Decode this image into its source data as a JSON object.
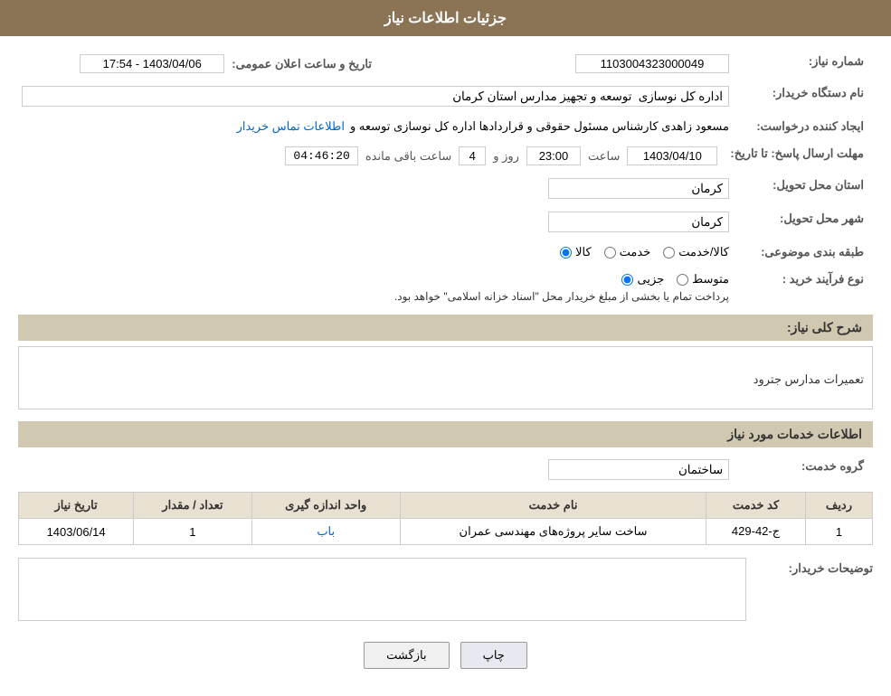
{
  "header": {
    "title": "جزئیات اطلاعات نیاز"
  },
  "section1": {
    "title": ""
  },
  "fields": {
    "shomara_niaz_label": "شماره نیاز:",
    "shomara_niaz_value": "1103004323000049",
    "tarikh_label": "تاریخ و ساعت اعلان عمومی:",
    "tarikh_value": "1403/04/06 - 17:54",
    "nam_dastgah_label": "نام دستگاه خریدار:",
    "nam_dastgah_value": "اداره کل نوسازی  توسعه و تجهیز مدارس استان کرمان",
    "ijad_label": "ایجاد کننده درخواست:",
    "ijad_value": "مسعود زاهدی کارشناس مسئول حقوقی و قراردادها اداره کل نوسازی  توسعه و",
    "ijad_link": "اطلاعات تماس خریدار",
    "mohlet_label": "مهلت ارسال پاسخ: تا تاریخ:",
    "mohlet_date": "1403/04/10",
    "mohlet_saat_label": "ساعت",
    "mohlet_saat": "23:00",
    "mohlet_rooz_label": "روز و",
    "mohlet_rooz": "4",
    "mohlet_timer_label": "ساعت باقی مانده",
    "mohlet_timer": "04:46:20",
    "ostan_tahvil_label": "استان محل تحویل:",
    "ostan_tahvil_value": "کرمان",
    "shahr_tahvil_label": "شهر محل تحویل:",
    "shahr_tahvil_value": "کرمان",
    "tabaqe_label": "طبقه بندی موضوعی:",
    "tabaqe_options": [
      "کالا",
      "خدمت",
      "کالا/خدمت"
    ],
    "tabaqe_selected": "کالا",
    "noe_farayand_label": "نوع فرآیند خرید :",
    "noe_options": [
      "جزیی",
      "متوسط"
    ],
    "noe_selected": "جزیی",
    "noe_note": "پرداخت تمام یا بخشی از مبلغ خریدار محل \"اسناد خزانه اسلامی\" خواهد بود.",
    "sharh_label": "شرح کلی نیاز:",
    "sharh_value": "تعمیرات مدارس جترود"
  },
  "section_services": {
    "title": "اطلاعات خدمات مورد نیاز",
    "group_label": "گروه خدمت:",
    "group_value": "ساختمان",
    "table_headers": [
      "ردیف",
      "کد خدمت",
      "نام خدمت",
      "واحد اندازه گیری",
      "تعداد / مقدار",
      "تاریخ نیاز"
    ],
    "rows": [
      {
        "radif": "1",
        "kod": "ج-42-429",
        "nam": "ساخت سایر پروژه‌های مهندسی عمران",
        "vahed": "باب",
        "tedad": "1",
        "tarikh": "1403/06/14"
      }
    ]
  },
  "buyer_desc": {
    "label": "توضیحات خریدار:",
    "value": ""
  },
  "buttons": {
    "print": "چاپ",
    "back": "بازگشت"
  }
}
